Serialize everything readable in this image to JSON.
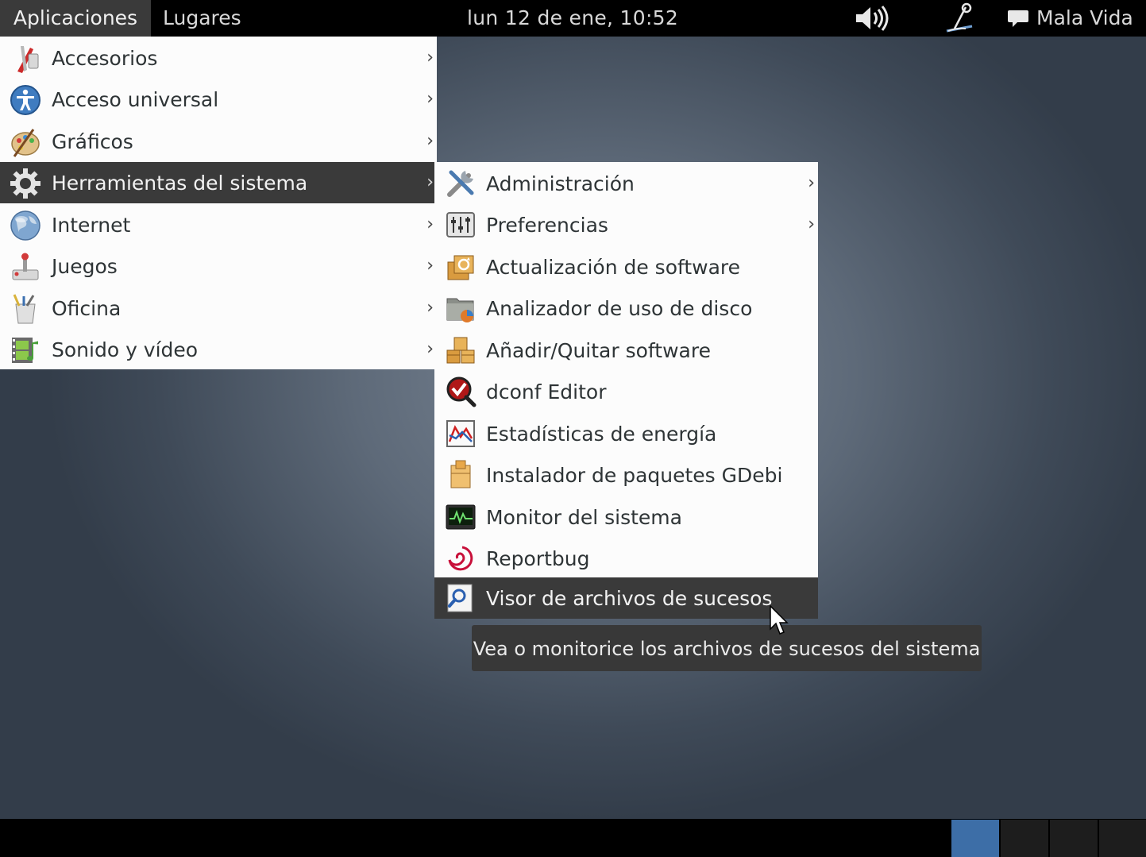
{
  "top_panel": {
    "applications": "Aplicaciones",
    "places": "Lugares",
    "clock": "lun 12 de ene, 10:52",
    "user": "Mala Vida",
    "icons": [
      "volume-icon",
      "network-icon",
      "chat-icon"
    ]
  },
  "menu": {
    "items": [
      {
        "label": "Accesorios",
        "icon": "accessories-icon",
        "submenu": true
      },
      {
        "label": "Acceso universal",
        "icon": "universal-access-icon",
        "submenu": true
      },
      {
        "label": "Gráficos",
        "icon": "graphics-icon",
        "submenu": true
      },
      {
        "label": "Herramientas del sistema",
        "icon": "system-tools-icon",
        "submenu": true,
        "active": true
      },
      {
        "label": "Internet",
        "icon": "internet-icon",
        "submenu": true
      },
      {
        "label": "Juegos",
        "icon": "games-icon",
        "submenu": true
      },
      {
        "label": "Oficina",
        "icon": "office-icon",
        "submenu": true
      },
      {
        "label": "Sonido y vídeo",
        "icon": "sound-video-icon",
        "submenu": true
      }
    ]
  },
  "submenu": {
    "items": [
      {
        "label": "Administración",
        "icon": "administration-icon",
        "submenu": true
      },
      {
        "label": "Preferencias",
        "icon": "preferences-icon",
        "submenu": true
      },
      {
        "label": "Actualización de software",
        "icon": "software-update-icon"
      },
      {
        "label": "Analizador de uso de disco",
        "icon": "disk-usage-icon"
      },
      {
        "label": "Añadir/Quitar software",
        "icon": "add-remove-software-icon"
      },
      {
        "label": "dconf Editor",
        "icon": "dconf-editor-icon"
      },
      {
        "label": "Estadísticas de energía",
        "icon": "power-statistics-icon"
      },
      {
        "label": "Instalador de paquetes GDebi",
        "icon": "gdebi-icon"
      },
      {
        "label": "Monitor del sistema",
        "icon": "system-monitor-icon"
      },
      {
        "label": "Reportbug",
        "icon": "reportbug-icon"
      },
      {
        "label": "Visor de archivos de sucesos",
        "icon": "log-viewer-icon",
        "active": true
      }
    ]
  },
  "tooltip": {
    "text": "Vea o monitorice los archivos de sucesos del sistema"
  },
  "bottom_panel": {
    "workspaces": 4,
    "active_workspace": 1
  },
  "arrow_glyph": "›",
  "colors": {
    "panel": "#000000",
    "highlight": "#3a3a3a",
    "menu_bg": "#fcfcfc",
    "active_workspace": "#3d6ea7"
  }
}
